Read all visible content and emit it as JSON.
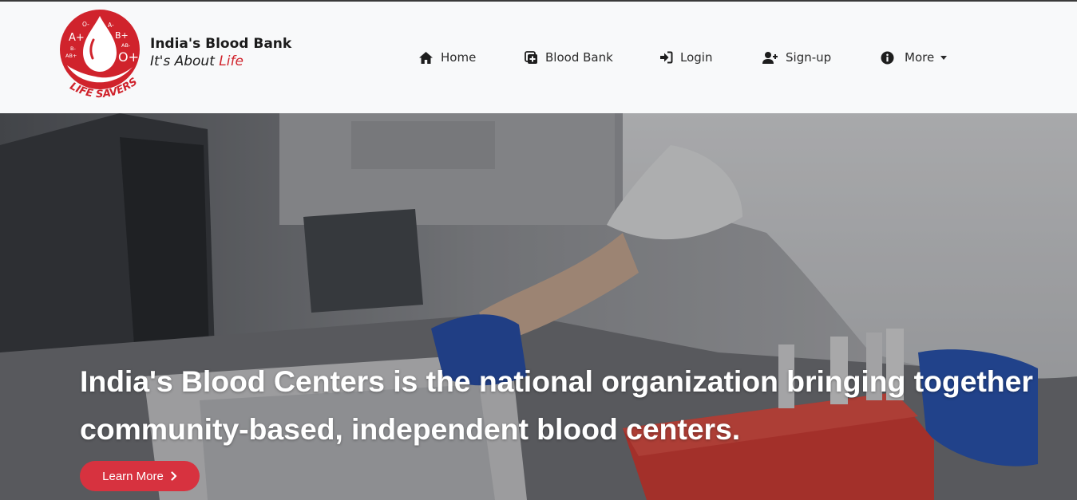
{
  "brand": {
    "logo": {
      "blood_types": [
        "A+",
        "O-",
        "A-",
        "B+",
        "B-",
        "AB-",
        "AB+",
        "O+"
      ],
      "ring_text": "LIFE SAVERS"
    },
    "title": "India's Blood Bank",
    "tagline_prefix": "It's About ",
    "tagline_highlight": "Life"
  },
  "nav": {
    "items": [
      {
        "label": "Home",
        "icon": "home-icon"
      },
      {
        "label": "Blood Bank",
        "icon": "medical-plus-icon"
      },
      {
        "label": "Login",
        "icon": "sign-in-icon"
      },
      {
        "label": "Sign-up",
        "icon": "user-plus-icon"
      },
      {
        "label": "More",
        "icon": "info-circle-icon",
        "dropdown": true
      }
    ]
  },
  "hero": {
    "headline_line1": "India's Blood Centers is the national organization bringing together",
    "headline_line2": "community-based, independent blood centers.",
    "cta_label": "Learn More",
    "cta_icon": "chevron-right-icon"
  },
  "colors": {
    "brand_red": "#d0232c",
    "button_red": "#d7323f",
    "navbar_bg": "#f8f9fa",
    "text_dark": "#2a2a2a"
  }
}
